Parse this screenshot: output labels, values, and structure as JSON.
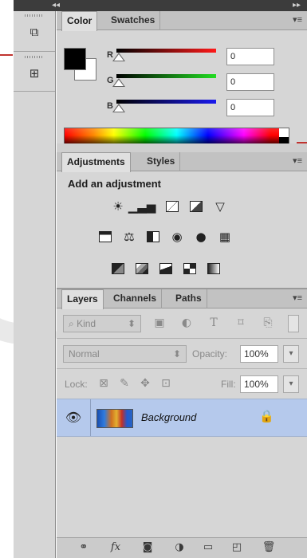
{
  "top_strip": {
    "collapse_left": "◂◂",
    "collapse_right": "▸▸"
  },
  "color_panel": {
    "tabs": [
      "Color",
      "Swatches"
    ],
    "channels": [
      {
        "label": "R",
        "value": "0",
        "track_color": "#ff1a1a"
      },
      {
        "label": "G",
        "value": "0",
        "track_color": "#22dd22"
      },
      {
        "label": "B",
        "value": "0",
        "track_color": "#1a1aee"
      }
    ],
    "foreground_color": "#000000",
    "background_color": "#ffffff"
  },
  "adjustments_panel": {
    "tabs": [
      "Adjustments",
      "Styles"
    ],
    "heading": "Add an adjustment",
    "icons_row1": [
      "brightness-contrast-icon",
      "levels-icon",
      "curves-icon",
      "exposure-icon",
      "vibrance-icon"
    ],
    "icons_row2": [
      "hue-saturation-icon",
      "color-balance-icon",
      "black-white-icon",
      "photo-filter-icon",
      "channel-mixer-icon",
      "color-lookup-icon"
    ],
    "icons_row3": [
      "invert-icon",
      "posterize-icon",
      "threshold-icon",
      "selective-color-icon",
      "gradient-map-icon"
    ]
  },
  "layers_panel": {
    "tabs": [
      "Layers",
      "Channels",
      "Paths"
    ],
    "filter": {
      "kind_label": "Kind",
      "filter_icons": [
        "pixel-filter-icon",
        "adjustment-filter-icon",
        "type-filter-icon",
        "shape-filter-icon",
        "smart-object-filter-icon"
      ]
    },
    "blend_mode": "Normal",
    "opacity_label": "Opacity:",
    "opacity_value": "100%",
    "lock_label": "Lock:",
    "fill_label": "Fill:",
    "fill_value": "100%",
    "layers": [
      {
        "name": "Background",
        "visible": true,
        "locked": true
      }
    ],
    "footer_icons": [
      "link-layers-icon",
      "fx-icon",
      "mask-icon",
      "adjustment-layer-icon",
      "group-folder-icon",
      "new-layer-icon",
      "trash-icon"
    ]
  },
  "glyphs": {
    "panel_menu": "▾≡",
    "dropdown": "⬍",
    "stepper": "▾",
    "eye": "👁",
    "lock": "🔒",
    "search": "⌕",
    "fx": "fx"
  }
}
